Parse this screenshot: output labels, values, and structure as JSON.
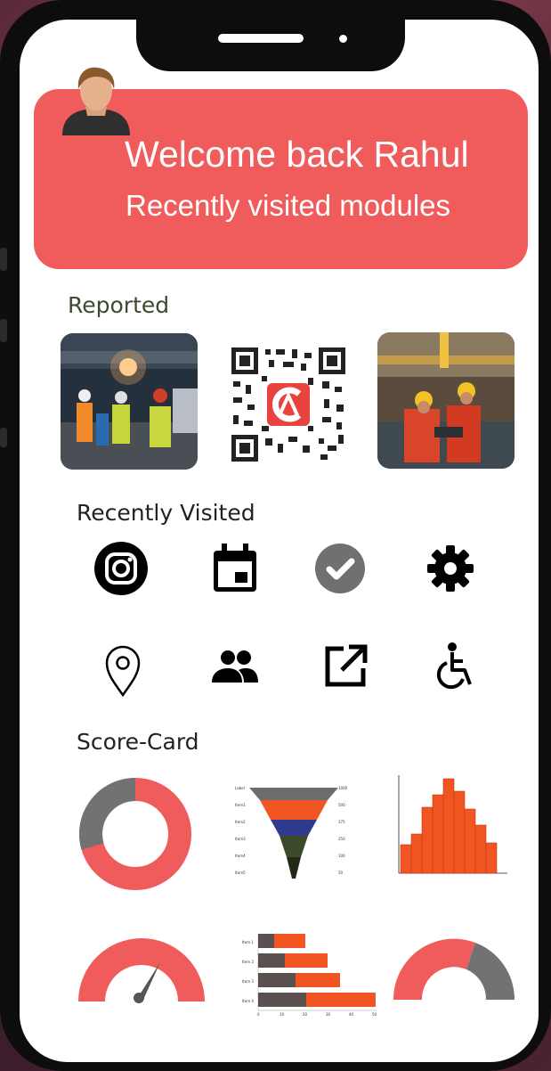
{
  "header": {
    "welcome": "Welcome back Rahul",
    "subtitle": "Recently visited modules"
  },
  "sections": {
    "reported": "Reported",
    "recently_visited": "Recently Visited",
    "score_card": "Score-Card"
  },
  "icons": [
    "instagram-icon",
    "calendar-icon",
    "check-circle-icon",
    "gear-icon",
    "map-pin-icon",
    "people-icon",
    "external-link-icon",
    "wheelchair-icon"
  ],
  "colors": {
    "accent": "#f05b5b",
    "grey": "#6e6e6e",
    "orange": "#f05522"
  }
}
